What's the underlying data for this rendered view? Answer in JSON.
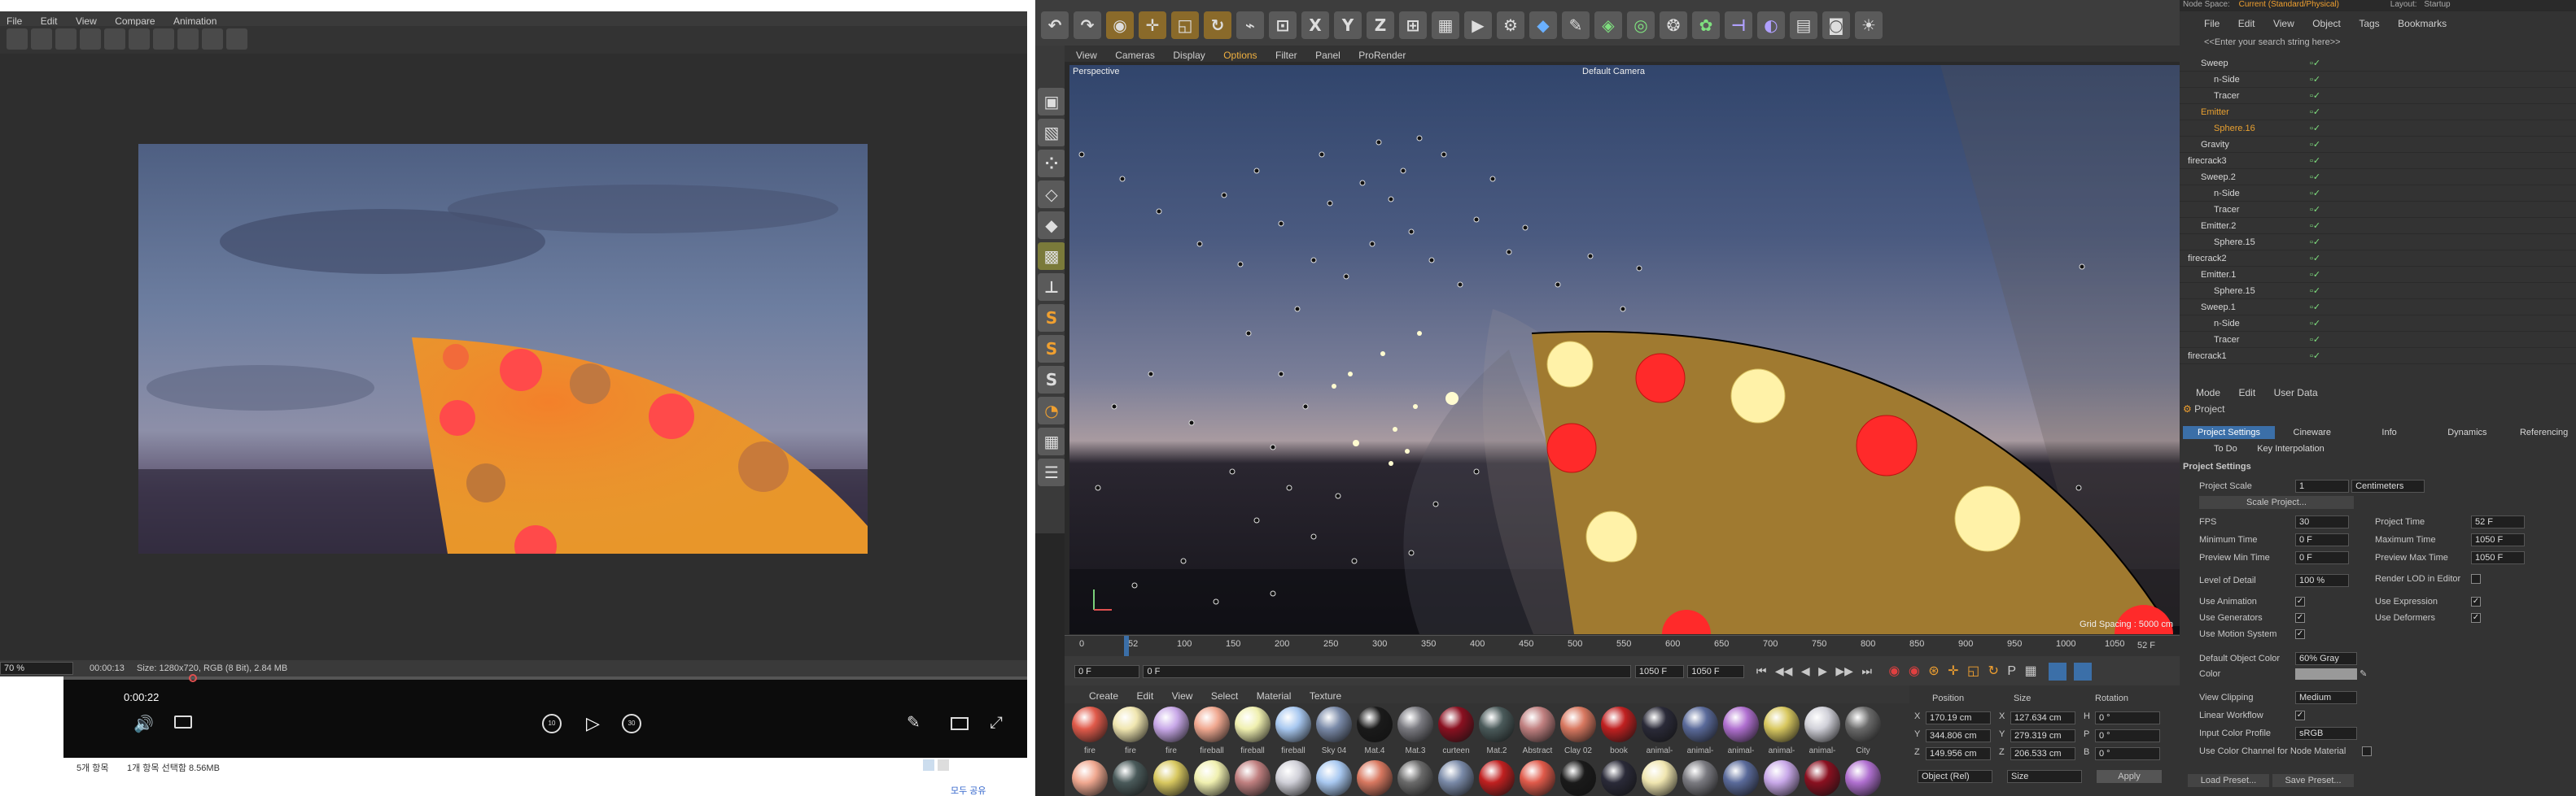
{
  "viewer": {
    "menu": [
      "File",
      "Edit",
      "View",
      "Compare",
      "Animation"
    ],
    "zoom": "70 %",
    "time": "00:00:13",
    "info": "Size: 1280x720, RGB (8 Bit), 2.84 MB"
  },
  "media_player": {
    "time": "0:00:22",
    "skip_back": "10",
    "skip_fwd": "30"
  },
  "explorer": {
    "count": "5개 항목",
    "selected": "1개 항목 선택함 8.56MB",
    "share": "모두 공유"
  },
  "c4d": {
    "top_menu": [
      "File",
      "Edit",
      "View",
      "Object",
      "Tags",
      "Bookmarks"
    ],
    "right_top": [
      "Node Space:",
      "Current (Standard/Physical)",
      "Layout:",
      "Startup"
    ],
    "viewport_menu": [
      "View",
      "Cameras",
      "Display",
      "Options",
      "Filter",
      "Panel",
      "ProRender"
    ],
    "viewport_name": "Perspective",
    "camera": "Default Camera",
    "grid_spacing": "Grid Spacing : 5000 cm",
    "timeline_ticks": [
      "0",
      "52",
      "100",
      "150",
      "200",
      "250",
      "300",
      "350",
      "400",
      "450",
      "500",
      "550",
      "600",
      "650",
      "700",
      "750",
      "800",
      "850",
      "900",
      "950",
      "1000",
      "1050"
    ],
    "current_frame": "52 F",
    "frame_start": "0 F",
    "frame_in": "0 F",
    "frame_out": "1050 F",
    "frame_end": "1050 F",
    "search_placeholder": "<<Enter your search string here>>",
    "objects": [
      {
        "name": "Sweep",
        "indent": 1
      },
      {
        "name": "n-Side",
        "indent": 2
      },
      {
        "name": "Tracer",
        "indent": 2
      },
      {
        "name": "Emitter",
        "indent": 1,
        "color": "#e8a030"
      },
      {
        "name": "Sphere.16",
        "indent": 2,
        "color": "#e8a030"
      },
      {
        "name": "Gravity",
        "indent": 1
      },
      {
        "name": "firecrack3",
        "indent": 0
      },
      {
        "name": "Sweep.2",
        "indent": 1
      },
      {
        "name": "n-Side",
        "indent": 2
      },
      {
        "name": "Tracer",
        "indent": 2
      },
      {
        "name": "Emitter.2",
        "indent": 1
      },
      {
        "name": "Sphere.15",
        "indent": 2
      },
      {
        "name": "firecrack2",
        "indent": 0
      },
      {
        "name": "Emitter.1",
        "indent": 1
      },
      {
        "name": "Sphere.15",
        "indent": 2
      },
      {
        "name": "Sweep.1",
        "indent": 1
      },
      {
        "name": "n-Side",
        "indent": 2
      },
      {
        "name": "Tracer",
        "indent": 2
      },
      {
        "name": "firecrack1",
        "indent": 0
      }
    ],
    "attr_menu": [
      "Mode",
      "Edit",
      "User Data"
    ],
    "attr_object": "Project",
    "attr_tabs": [
      "Project Settings",
      "Cineware",
      "Info",
      "Dynamics",
      "Referencing"
    ],
    "attr_tabs2": [
      "To Do",
      "Key Interpolation"
    ],
    "section": "Project Settings",
    "project_scale_label": "Project Scale",
    "project_scale": "1",
    "project_scale_unit": "Centimeters",
    "scale_project": "Scale Project...",
    "fps_label": "FPS",
    "fps": "30",
    "ptime_label": "Project Time",
    "ptime": "52 F",
    "mintime_label": "Minimum Time",
    "mintime": "0 F",
    "maxtime_label": "Maximum Time",
    "maxtime": "1050 F",
    "prevmin_label": "Preview Min Time",
    "prevmin": "0 F",
    "prevmax_label": "Preview Max Time",
    "prevmax": "1050 F",
    "lod_label": "Level of Detail",
    "lod": "100 %",
    "rlod_label": "Render LOD in Editor",
    "use_anim": "Use Animation",
    "use_expr": "Use Expression",
    "use_gen": "Use Generators",
    "use_def": "Use Deformers",
    "use_motion": "Use Motion System",
    "doc_label": "Default Object Color",
    "doc": "60% Gray",
    "color_label": "Color",
    "vclip_label": "View Clipping",
    "vclip": "Medium",
    "linear_label": "Linear Workflow",
    "icp_label": "Input Color Profile",
    "icp": "sRGB",
    "ucc_label": "Use Color Channel for Node Material",
    "load_preset": "Load Preset...",
    "save_preset": "Save Preset...",
    "mat_menu": [
      "Create",
      "Edit",
      "View",
      "Select",
      "Material",
      "Texture"
    ],
    "materials": [
      {
        "name": "fire",
        "color": "#e05a4a"
      },
      {
        "name": "fire",
        "color": "#f0e6b0"
      },
      {
        "name": "fire",
        "color": "#c8a8e8"
      },
      {
        "name": "fireball",
        "color": "#f0a890"
      },
      {
        "name": "fireball",
        "color": "#f0f0b0"
      },
      {
        "name": "fireball",
        "color": "#a8c8f0"
      },
      {
        "name": "Sky 04",
        "color": "#7a8aa8"
      },
      {
        "name": "Mat.4",
        "color": "#1a1a1a"
      },
      {
        "name": "Mat.3",
        "color": "#7a7a80"
      },
      {
        "name": "curteen",
        "color": "#8a1020"
      },
      {
        "name": "Mat.2",
        "color": "#4a5a5a"
      },
      {
        "name": "Abstract",
        "color": "#c08080"
      },
      {
        "name": "Clay 02",
        "color": "#d87860"
      },
      {
        "name": "book",
        "color": "#c02020"
      },
      {
        "name": "animal-",
        "color": "#2a2a38"
      },
      {
        "name": "animal-",
        "color": "#5a6a9a"
      },
      {
        "name": "animal-",
        "color": "#b070d0"
      },
      {
        "name": "animal-",
        "color": "#d8c860"
      },
      {
        "name": "animal-",
        "color": "#d0d0d8"
      },
      {
        "name": "City",
        "color": "#6a6a6a"
      }
    ],
    "coord_headers": [
      "Position",
      "Size",
      "Rotation"
    ],
    "coords": [
      {
        "axis": "X",
        "pos": "170.19 cm",
        "sizeaxis": "X",
        "size": "127.634 cm",
        "rotaxis": "H",
        "rot": "0 °"
      },
      {
        "axis": "Y",
        "pos": "344.806 cm",
        "sizeaxis": "Y",
        "size": "279.319 cm",
        "rotaxis": "P",
        "rot": "0 °"
      },
      {
        "axis": "Z",
        "pos": "149.956 cm",
        "sizeaxis": "Z",
        "size": "206.533 cm",
        "rotaxis": "B",
        "rot": "0 °"
      }
    ],
    "coord_mode": "Object (Rel)",
    "coord_size_mode": "Size",
    "apply": "Apply"
  }
}
